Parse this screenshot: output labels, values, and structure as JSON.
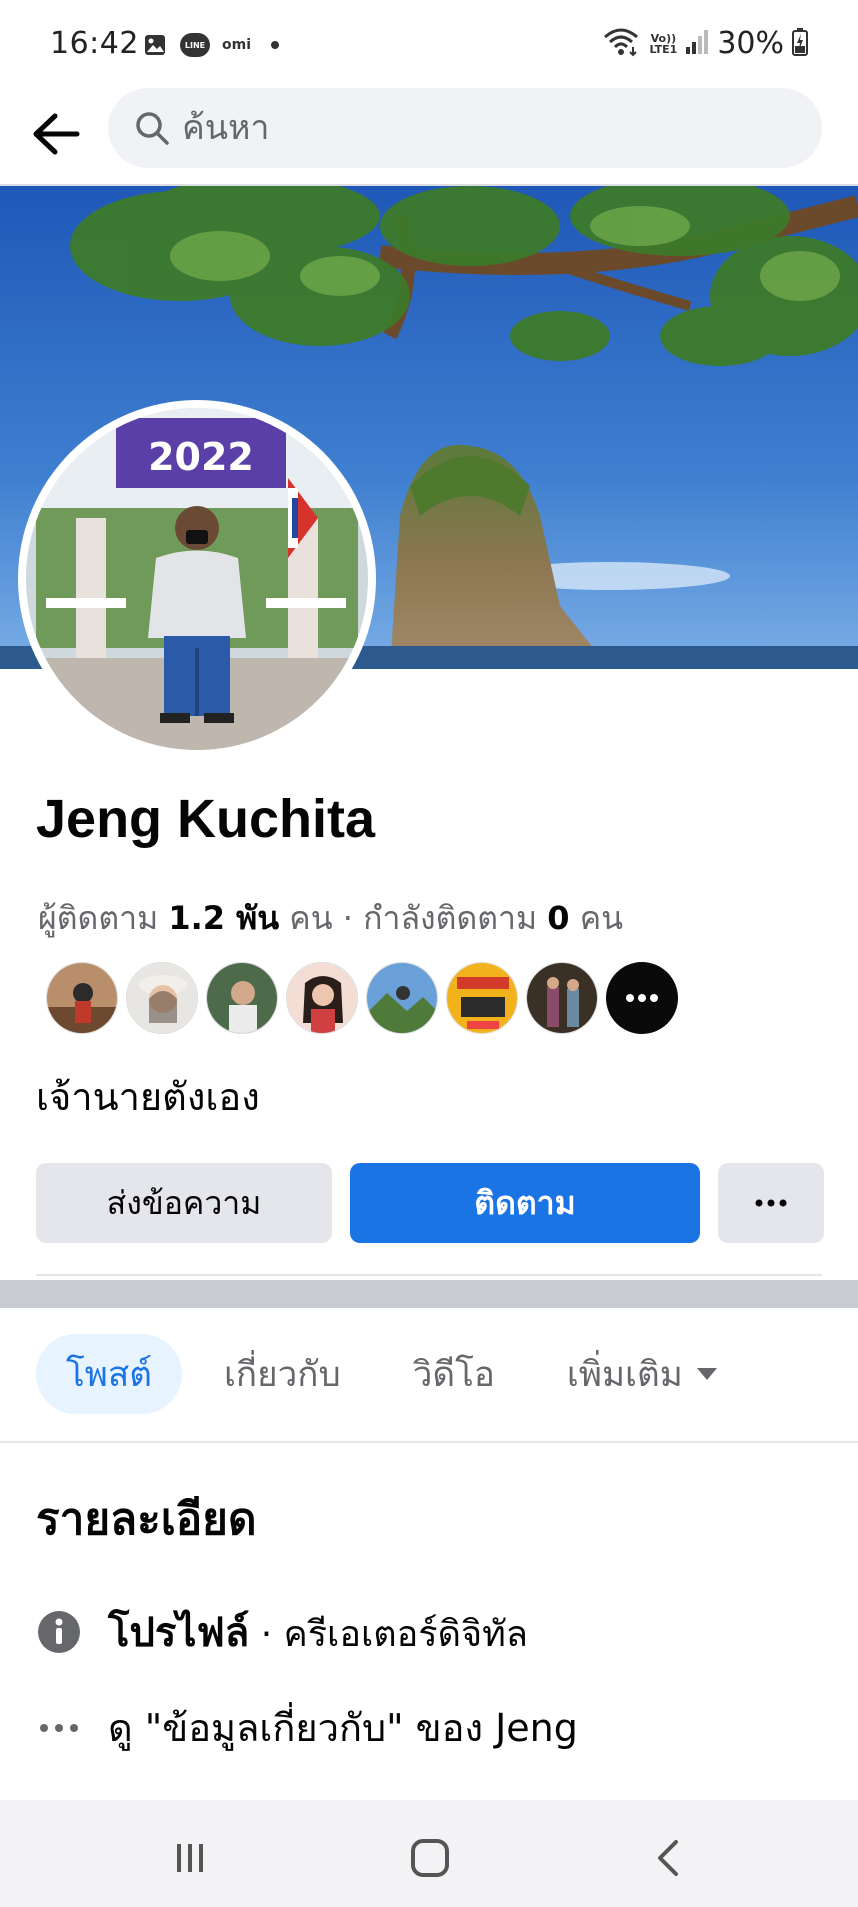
{
  "status_bar": {
    "time": "16:42",
    "line_badge": "LINE",
    "omi_label": "omi",
    "volte_top": "Vo))",
    "volte_bottom": "LTE1",
    "battery": "30%"
  },
  "search": {
    "placeholder": "ค้นหา"
  },
  "profile": {
    "name": "Jeng Kuchita",
    "followers_label": "ผู้ติดตาม",
    "followers_count": "1.2 พัน",
    "followers_unit": "คน",
    "separator": "·",
    "following_label": "กำลังติดตาม",
    "following_count": "0",
    "following_unit": "คน",
    "bio": "เจ้านายตังเอง",
    "avatar_banner_text": "2022"
  },
  "actions": {
    "message": "ส่งข้อความ",
    "follow": "ติดตาม"
  },
  "tabs": [
    {
      "label": "โพสต์",
      "active": true
    },
    {
      "label": "เกี่ยวกับ",
      "active": false
    },
    {
      "label": "วิดีโอ",
      "active": false
    },
    {
      "label": "เพิ่มเติม",
      "active": false
    }
  ],
  "details": {
    "title": "รายละเอียด",
    "profile_label": "โปรไฟล์",
    "profile_sub": " · ครีเอเตอร์ดิจิทัล",
    "about_link": "ดู \"ข้อมูลเกี่ยวกับ\" ของ Jeng"
  },
  "colors": {
    "accent": "#1b74e4",
    "accent_light": "#e7f3ff",
    "secondary_button": "#e4e6eb",
    "muted_text": "#65676b"
  }
}
